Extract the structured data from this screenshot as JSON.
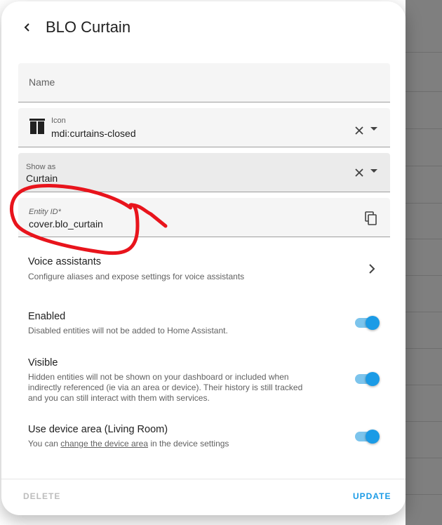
{
  "dialog": {
    "title": "BLO Curtain"
  },
  "fields": {
    "name": {
      "placeholder": "Name",
      "value": ""
    },
    "icon": {
      "label": "Icon",
      "value": "mdi:curtains-closed"
    },
    "show_as": {
      "label": "Show as",
      "value": "Curtain"
    },
    "entity_id": {
      "label": "Entity ID*",
      "value": "cover.blo_curtain"
    }
  },
  "rows": {
    "voice": {
      "title": "Voice assistants",
      "desc": "Configure aliases and expose settings for voice assistants"
    },
    "enabled": {
      "title": "Enabled",
      "desc": "Disabled entities will not be added to Home Assistant.",
      "on": true
    },
    "visible": {
      "title": "Visible",
      "desc_line1": "Hidden entities will not be shown on your dashboard or included when",
      "desc_line2": "indirectly referenced (ie via an area or device). Their history is still tracked",
      "desc_line3": "and you can still interact with them with services.",
      "on": true
    },
    "device_area": {
      "title": "Use device area (Living Room)",
      "desc_before": "You can ",
      "desc_link": "change the device area",
      "desc_after": " in the device settings",
      "on": true
    }
  },
  "footer": {
    "delete_label": "DELETE",
    "update_label": "UPDATE"
  },
  "icons": {
    "back": "chevron-left-icon",
    "curtains": "curtains-closed-icon",
    "clear": "close-icon",
    "dropdown": "menu-down-icon",
    "copy": "content-copy-icon",
    "chevron": "chevron-right-icon"
  },
  "colors": {
    "accent": "#1b9be6",
    "toggle_track": "#7cc4ec",
    "annotation": "#e8141c",
    "delete_disabled": "#bdbdbd"
  }
}
